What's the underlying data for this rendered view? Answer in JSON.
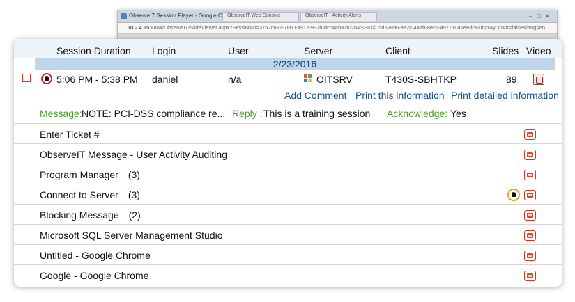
{
  "background_window": {
    "title": "ObserveIT Session Player - Google Chrome",
    "tabs": [
      "ObserveIT Web Console",
      "ObserveIT - Activity Alerts"
    ],
    "url_host": "10.2.4.15",
    "url_rest": ":4884/ObserveIT/SlideViewer.aspx?SessionID=3752c687-7800-4912-997b-dcc4aba7f028&SSID=05d52896-aa2c-44ab-8ec1-497710a1eedc&DisplayOnAir=false&lang=en"
  },
  "table": {
    "columns": [
      "Session Duration",
      "Login",
      "User",
      "Server",
      "Client",
      "Slides",
      "Video"
    ],
    "date": "2/23/2016",
    "session": {
      "expand_symbol": "−",
      "duration": "5:06 PM - 5:38 PM",
      "login": "daniel",
      "user": "n/a",
      "server": "OITSRV",
      "client": "T430S-SBHTKP",
      "slides": "89"
    },
    "links": {
      "add_comment": "Add Comment",
      "print_info": "Print this information",
      "print_detailed": "Print detailed information"
    },
    "notes": {
      "message_label": "Message:",
      "message_text": "NOTE: PCI-DSS compliance re...",
      "reply_label": "Reply :",
      "reply_text": "This is a training session",
      "ack_label": "Acknowledge:",
      "ack_text": "Yes"
    },
    "activities": [
      {
        "label": "Enter Ticket #",
        "count": ""
      },
      {
        "label": "ObserveIT Message - User Activity Auditing",
        "count": ""
      },
      {
        "label": "Program Manager",
        "count": "(3)"
      },
      {
        "label": "Connect to Server",
        "count": "(3)"
      },
      {
        "label": "Blocking Message",
        "count": "(2)"
      },
      {
        "label": "Microsoft SQL Server Management Studio",
        "count": ""
      },
      {
        "label": "Untitled - Google Chrome",
        "count": ""
      },
      {
        "label": "Google - Google Chrome",
        "count": ""
      }
    ]
  },
  "colors": {
    "header_bg": "#eef3f8",
    "date_band": "#bed5ea",
    "link": "#1e4f8f",
    "label_green": "#4c9c2e",
    "alert_red": "#d4241d",
    "alert_orange": "#f0a21e"
  }
}
